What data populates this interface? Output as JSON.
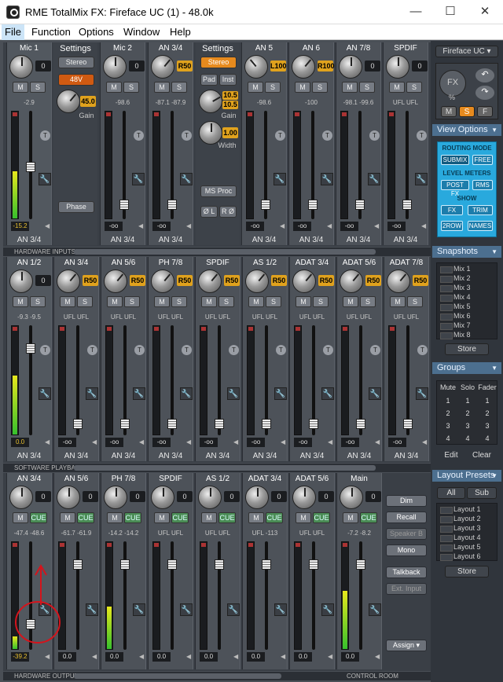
{
  "window": {
    "title": "RME TotalMix FX: Fireface UC (1) - 48.0k",
    "min": "—",
    "max": "☐",
    "close": "✕"
  },
  "menu": [
    "File",
    "Function",
    "Options",
    "Window",
    "Help"
  ],
  "labels": {
    "m": "M",
    "s": "S",
    "t": "T",
    "settings": "Settings",
    "stereo": "Stereo",
    "phantom": "48V",
    "gain": "Gain",
    "width": "Width",
    "phase": "Phase",
    "pad": "Pad",
    "inst": "Inst",
    "ms_proc": "MS Proc",
    "phase_l": "Ø L",
    "phase_r": "R Ø",
    "cue": "CUE",
    "wrench": "🔧",
    "collapse": "◀"
  },
  "hw_inputs": {
    "bar_label": "HARDWARE INPUTS",
    "mic1": {
      "name": "Mic 1",
      "knob": "0",
      "peak": "-2.9",
      "level": "-15.2",
      "foot": "AN 3/4",
      "meter": 0.45
    },
    "settings1": {
      "gain_value": "45.0"
    },
    "channels": [
      {
        "name": "Mic 2",
        "knob": "0",
        "peak": "-98.6",
        "level": "-oo",
        "foot": "AN 3/4"
      },
      {
        "name": "AN 3/4",
        "knob": "R50",
        "peak": "-87.1 -87.9",
        "level": "-oo",
        "foot": "AN 3/4"
      },
      {
        "name": "AN 5",
        "knob": "L100",
        "peak": "-98.6",
        "level": "-oo",
        "foot": "AN 3/4"
      },
      {
        "name": "AN 6",
        "knob": "R100",
        "peak": "-100",
        "level": "-oo",
        "foot": "AN 3/4"
      },
      {
        "name": "AN 7/8",
        "knob": "0",
        "peak": "-98.1 -99.6",
        "level": "-oo",
        "foot": "AN 3/4"
      },
      {
        "name": "SPDIF",
        "knob": "0",
        "peak": "UFL UFL",
        "level": "-oo",
        "foot": "AN 3/4"
      }
    ],
    "settings2": {
      "gain_value": "10.5",
      "gain_value2": "10.5",
      "width_value": "1.00"
    }
  },
  "sw_playback": {
    "bar_label": "SOFTWARE PLAYBACK",
    "channels": [
      {
        "name": "AN 1/2",
        "knob": "0",
        "peak": "-9.3 -9.5",
        "level": "0.0",
        "foot": "AN 3/4",
        "meter": 0.55
      },
      {
        "name": "AN 3/4",
        "knob": "R50",
        "peak": "UFL UFL",
        "level": "-oo",
        "foot": "AN 3/4"
      },
      {
        "name": "AN 5/6",
        "knob": "R50",
        "peak": "UFL UFL",
        "level": "-oo",
        "foot": "AN 3/4"
      },
      {
        "name": "PH 7/8",
        "knob": "R50",
        "peak": "UFL UFL",
        "level": "-oo",
        "foot": "AN 3/4"
      },
      {
        "name": "SPDIF",
        "knob": "R50",
        "peak": "UFL UFL",
        "level": "-oo",
        "foot": "AN 3/4"
      },
      {
        "name": "AS 1/2",
        "knob": "R50",
        "peak": "UFL UFL",
        "level": "-oo",
        "foot": "AN 3/4"
      },
      {
        "name": "ADAT 3/4",
        "knob": "R50",
        "peak": "UFL UFL",
        "level": "-oo",
        "foot": "AN 3/4"
      },
      {
        "name": "ADAT 5/6",
        "knob": "R50",
        "peak": "UFL UFL",
        "level": "-oo",
        "foot": "AN 3/4"
      },
      {
        "name": "ADAT 7/8",
        "knob": "R50",
        "peak": "UFL UFL",
        "level": "-oo",
        "foot": "AN 3/4"
      }
    ]
  },
  "hw_outputs": {
    "bar_label": "HARDWARE OUTPUTS",
    "channels": [
      {
        "name": "AN 3/4",
        "knob": "0",
        "peak": "-47.4 -48.6",
        "level": "-39.2",
        "meter": 0.12
      },
      {
        "name": "AN 5/6",
        "knob": "0",
        "peak": "-61.7 -61.9",
        "level": "0.0",
        "meter": 0.0
      },
      {
        "name": "PH 7/8",
        "knob": "0",
        "peak": "-14.2 -14.2",
        "level": "0.0",
        "meter": 0.4
      },
      {
        "name": "SPDIF",
        "knob": "0",
        "peak": "UFL UFL",
        "level": "0.0",
        "meter": 0.0
      },
      {
        "name": "AS 1/2",
        "knob": "0",
        "peak": "UFL UFL",
        "level": "0.0",
        "meter": 0.0
      },
      {
        "name": "ADAT 3/4",
        "knob": "0",
        "peak": "UFL -113",
        "level": "0.0",
        "meter": 0.0
      },
      {
        "name": "ADAT 5/6",
        "knob": "0",
        "peak": "UFL UFL",
        "level": "0.0",
        "meter": 0.0
      },
      {
        "name": "Main",
        "knob": "0",
        "peak": "-7.2 -8.2",
        "level": "0.0",
        "meter": 0.55
      }
    ],
    "control_room_label": "CONTROL ROOM",
    "buttons": {
      "dim": "Dim",
      "recall": "Recall",
      "speaker_b": "Speaker B",
      "mono": "Mono",
      "talkback": "Talkback",
      "ext_input": "Ext. Input",
      "assign": "Assign ▾"
    }
  },
  "sidebar": {
    "device": "Fireface UC ▾",
    "fx": "FX",
    "fx_pct": "%",
    "m": "M",
    "s": "S",
    "f": "F",
    "view_options": "View Options",
    "routing_mode": "ROUTING MODE",
    "submix": "SUBMIX",
    "free": "FREE",
    "level_meters": "LEVEL METERS",
    "post_fx": "POST FX",
    "rms": "RMS",
    "show": "SHOW",
    "fx_btn": "FX",
    "trim": "TRIM",
    "two_row": "2ROW",
    "names": "NAMES",
    "snapshots": "Snapshots",
    "mixes": [
      "Mix 1",
      "Mix 2",
      "Mix 3",
      "Mix 4",
      "Mix 5",
      "Mix 6",
      "Mix 7",
      "Mix 8"
    ],
    "store": "Store",
    "groups": "Groups",
    "group_headers": [
      "Mute",
      "Solo",
      "Fader"
    ],
    "group_rows": [
      [
        "1",
        "1",
        "1"
      ],
      [
        "2",
        "2",
        "2"
      ],
      [
        "3",
        "3",
        "3"
      ],
      [
        "4",
        "4",
        "4"
      ]
    ],
    "edit": "Edit",
    "clear": "Clear",
    "layout_presets": "Layout Presets",
    "all": "All",
    "sub": "Sub",
    "layouts": [
      "Layout 1",
      "Layout 2",
      "Layout 3",
      "Layout 4",
      "Layout 5",
      "Layout 6"
    ],
    "store2": "Store"
  },
  "colors": {
    "accent_orange": "#e68a1e",
    "cyan_panel": "#29a9dd",
    "cue_green": "#4a8c55",
    "annotation_red": "#d4141c"
  }
}
